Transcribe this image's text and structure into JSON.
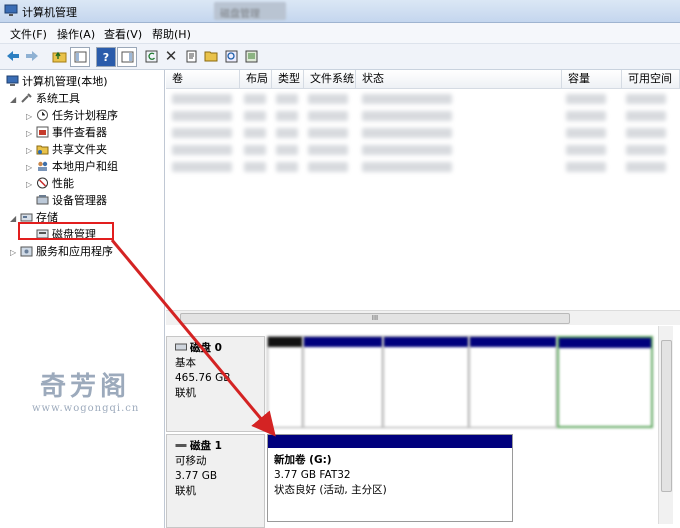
{
  "window": {
    "title": "计算机管理",
    "blurred_tab": "磁盘管理"
  },
  "menu": [
    "文件(F)",
    "操作(A)",
    "查看(V)",
    "帮助(H)"
  ],
  "toolbar_icons": [
    "back-icon",
    "forward-icon",
    "up-folder-icon",
    "show-tree-icon",
    "help-icon",
    "show-pane-icon",
    "refresh-icon",
    "delete-icon",
    "properties-icon",
    "open-icon",
    "search-icon",
    "export-icon"
  ],
  "tree": {
    "root": "计算机管理(本地)",
    "system_tools": "系统工具",
    "task_scheduler": "任务计划程序",
    "event_viewer": "事件查看器",
    "shared_folders": "共享文件夹",
    "local_users": "本地用户和组",
    "performance": "性能",
    "device_manager": "设备管理器",
    "storage": "存储",
    "disk_management": "磁盘管理",
    "services_apps": "服务和应用程序"
  },
  "watermark": {
    "big": "奇芳阁",
    "small": "www.wogongqi.cn"
  },
  "columns": [
    "卷",
    "布局",
    "类型",
    "文件系统",
    "状态",
    "容量",
    "可用空间"
  ],
  "disk0": {
    "name": "磁盘 0",
    "type": "基本",
    "size": "465.76 GB",
    "status": "联机"
  },
  "disk1": {
    "name": "磁盘 1",
    "type": "可移动",
    "size": "3.77 GB",
    "status": "联机"
  },
  "volume_g": {
    "name": "新加卷  (G:)",
    "info": "3.77 GB FAT32",
    "status": "状态良好 (活动, 主分区)"
  },
  "scroll_label": "III",
  "colors": {
    "accent": "#00007d",
    "highlight_box": "#e21e1e",
    "arrow": "#d42323"
  }
}
